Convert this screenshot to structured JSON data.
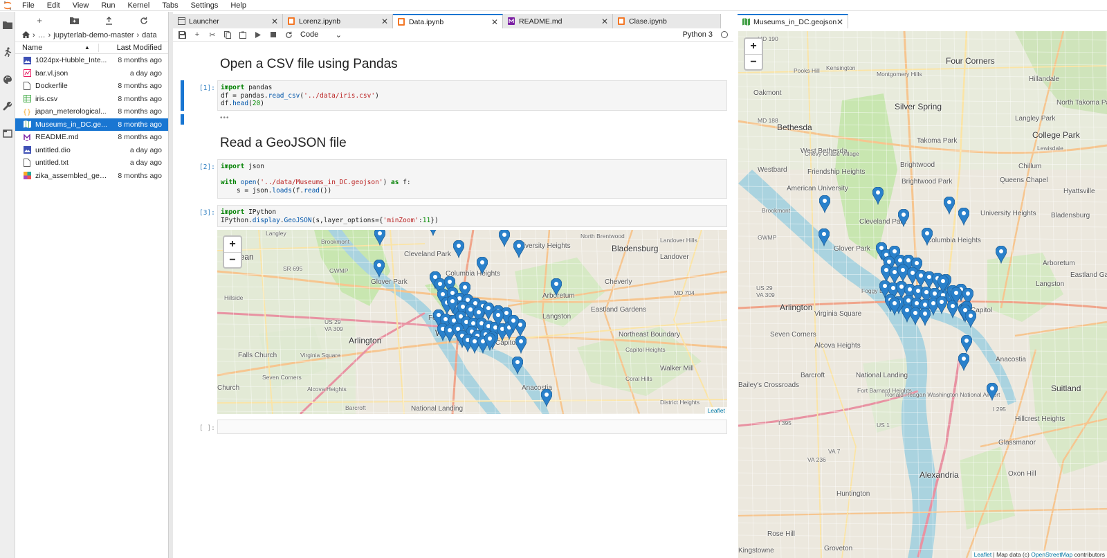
{
  "menubar": {
    "items": [
      "File",
      "Edit",
      "View",
      "Run",
      "Kernel",
      "Tabs",
      "Settings",
      "Help"
    ]
  },
  "filebrowser": {
    "breadcrumb": [
      "…",
      "jupyterlab-demo-master",
      "data"
    ],
    "header": {
      "name": "Name",
      "modified": "Last Modified"
    },
    "files": [
      {
        "name": "1024px-Hubble_Inte...",
        "modified": "8 months ago",
        "icon": "image-icon",
        "color": "#3f51b5"
      },
      {
        "name": "bar.vl.json",
        "modified": "a day ago",
        "icon": "vega-icon",
        "color": "#e91e63"
      },
      {
        "name": "Dockerfile",
        "modified": "8 months ago",
        "icon": "file-icon",
        "color": "#616161"
      },
      {
        "name": "iris.csv",
        "modified": "8 months ago",
        "icon": "spreadsheet-icon",
        "color": "#4caf50"
      },
      {
        "name": "japan_meterological...",
        "modified": "8 months ago",
        "icon": "json-icon",
        "color": "#f9a825"
      },
      {
        "name": "Museums_in_DC.ge...",
        "modified": "8 months ago",
        "icon": "map-icon",
        "color": "#43a047",
        "selected": true
      },
      {
        "name": "README.md",
        "modified": "8 months ago",
        "icon": "markdown-icon",
        "color": "#7b1fa2"
      },
      {
        "name": "untitled.dio",
        "modified": "a day ago",
        "icon": "image-icon",
        "color": "#3f51b5"
      },
      {
        "name": "untitled.txt",
        "modified": "a day ago",
        "icon": "file-icon",
        "color": "#616161"
      },
      {
        "name": "zika_assembled_gen...",
        "modified": "8 months ago",
        "icon": "genome-icon",
        "color": "#ab47bc"
      }
    ]
  },
  "tabs": [
    {
      "label": "Launcher",
      "icon": "launcher-icon",
      "active": false
    },
    {
      "label": "Lorenz.ipynb",
      "icon": "notebook-icon",
      "active": false
    },
    {
      "label": "Data.ipynb",
      "icon": "notebook-icon",
      "active": true
    },
    {
      "label": "README.md",
      "icon": "markdown-icon",
      "active": false
    },
    {
      "label": "Clase.ipynb",
      "icon": "notebook-icon",
      "active": false
    }
  ],
  "right_tab": {
    "label": "Museums_in_DC.geojson",
    "icon": "map-icon"
  },
  "notebook_toolbar": {
    "cell_type": "Code",
    "kernel": "Python 3"
  },
  "notebook": {
    "heading1": "Open a CSV file using Pandas",
    "heading2": "Read a GeoJSON file",
    "cell1": {
      "prompt": "[1]:",
      "lines": [
        "import pandas",
        "df = pandas.read_csv('../data/iris.csv')",
        "df.head(20)"
      ]
    },
    "cell1_output_collapsed": "•••",
    "cell2": {
      "prompt": "[2]:",
      "lines": [
        "import json",
        "",
        "with open('../data/Museums_in_DC.geojson') as f:",
        "    s = json.loads(f.read())"
      ]
    },
    "cell3": {
      "prompt": "[3]:",
      "lines": [
        "import IPython",
        "IPython.display.GeoJSON(s,layer_options={'minZoom':11})"
      ]
    },
    "cell4": {
      "prompt": "[ ]:"
    }
  },
  "map_inline": {
    "attribution": "Leaflet",
    "labels": [
      "Langley",
      "Brookmont",
      "Cleveland Park",
      "Glover Park",
      "Columbia Heights",
      "University Heights",
      "North Brentwood",
      "Bladensburg",
      "Landover Hills",
      "Landover",
      "Arboretum",
      "Langston",
      "Eastland Gardens",
      "Northeast Boundary",
      "Capitol Heights",
      "Walker Mill",
      "Coral Hills",
      "District Heights",
      "Arlington",
      "Falls Church",
      "Virginia Square",
      "Seven Corners",
      "Alcova Heights",
      "Barcroft",
      "National Landing",
      "McLean",
      "Foggy Bottom",
      "Washington",
      "Capitol",
      "Anacostia",
      "Cheverly",
      "Church",
      "SR 695",
      "GWMP",
      "US 29",
      "VA 309",
      "MD 704",
      "Hillside"
    ]
  },
  "map_right": {
    "attribution_prefix": "Leaflet",
    "attribution_mid": " | Map data (c) ",
    "attribution_link": "OpenStreetMap",
    "attribution_suffix": " contributors",
    "labels": [
      "MD 190",
      "Kensington",
      "Four Corners",
      "Pooks Hill",
      "Montgomery Hills",
      "Hillandale",
      "Oakmont",
      "Silver Spring",
      "North Takoma Park",
      "Bethesda",
      "West Bethesda",
      "MD 188",
      "Takoma Park",
      "Langley Park",
      "College Park",
      "Chevy Chase Village",
      "Lewisdale",
      "Westbard",
      "Friendship Heights",
      "Brightwood",
      "Chillum",
      "American University",
      "Brightwood Park",
      "Queens Chapel",
      "Hyattsville",
      "Brookmont",
      "Cleveland Park",
      "University Heights",
      "Bladensburg",
      "GWMP",
      "Glover Park",
      "Columbia Heights",
      "Arboretum",
      "US 29",
      "VA 309",
      "Langston",
      "Eastland Gardens",
      "Arlington",
      "Virginia Square",
      "Capitol",
      "Seven Corners",
      "Alcova Heights",
      "Barcroft",
      "Anacostia",
      "Bailey's Crossroads",
      "National Landing",
      "Fort Barnard Heights",
      "I 395",
      "US 1",
      "Suitland",
      "Hillcrest Heights",
      "Glassmanor",
      "Alexandria",
      "Oxon Hill",
      "Huntington",
      "Rose Hill",
      "Groveton",
      "Kingstowne",
      "VA 7",
      "VA 236",
      "I 295",
      "Ronald Reagan Washington National Airport",
      "Foggy Bottom"
    ]
  },
  "colors": {
    "accent": "#1976d2",
    "marker": "#2a81cb",
    "map_bg": "#ece8de",
    "water": "#aad3df",
    "park": "#c8e6b0"
  }
}
